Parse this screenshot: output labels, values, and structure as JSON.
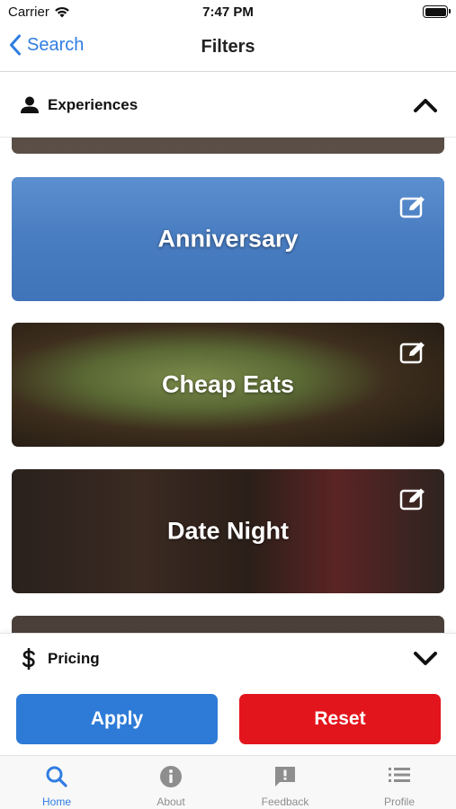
{
  "status_bar": {
    "carrier": "Carrier",
    "time": "7:47 PM"
  },
  "nav": {
    "back_label": "Search",
    "title": "Filters"
  },
  "sections": {
    "experiences": {
      "title": "Experiences",
      "icon": "person-icon",
      "expanded": true
    },
    "pricing": {
      "title": "Pricing",
      "icon": "dollar-icon",
      "expanded": false
    }
  },
  "experiences": [
    {
      "label": "Anniversary",
      "image": "restaurant-crowd-blue"
    },
    {
      "label": "Cheap Eats",
      "image": "eat-here-sign"
    },
    {
      "label": "Date Night",
      "image": "couple-dining"
    }
  ],
  "buttons": {
    "apply": "Apply",
    "reset": "Reset"
  },
  "tabs": [
    {
      "label": "Home",
      "icon": "search-icon",
      "active": true
    },
    {
      "label": "About",
      "icon": "info-icon",
      "active": false
    },
    {
      "label": "Feedback",
      "icon": "feedback-icon",
      "active": false
    },
    {
      "label": "Profile",
      "icon": "list-icon",
      "active": false
    }
  ],
  "colors": {
    "accent": "#2f7de1",
    "apply": "#2d7bd7",
    "reset": "#e3151c"
  }
}
